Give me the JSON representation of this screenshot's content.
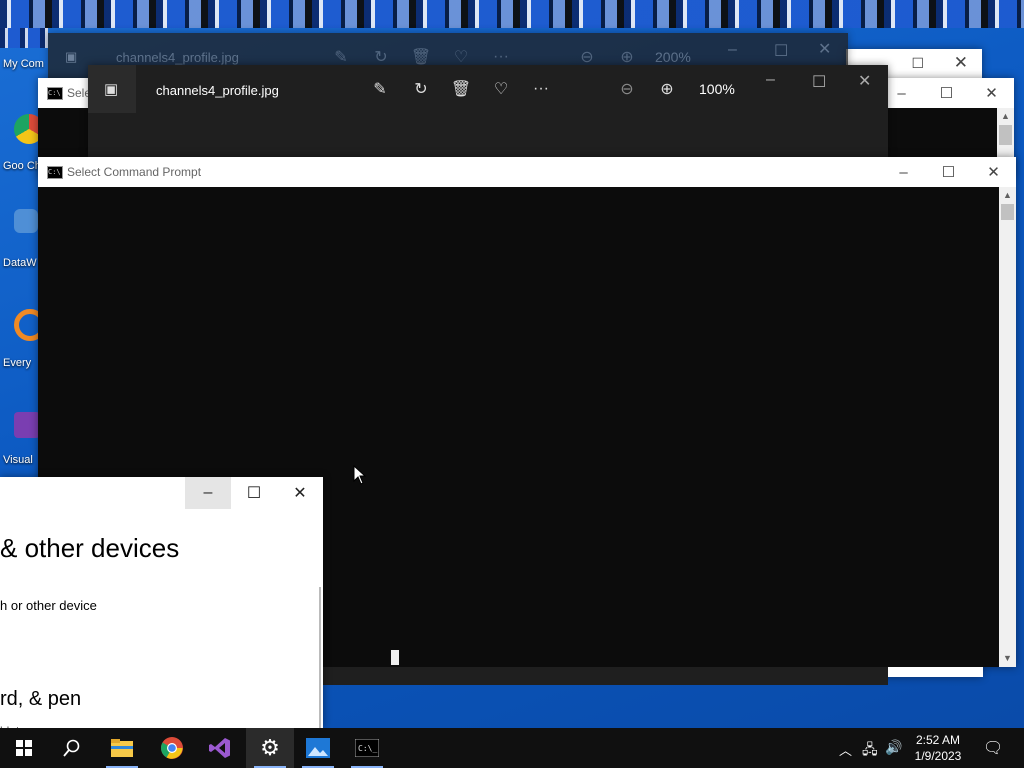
{
  "desktop": {
    "icons": [
      {
        "label": "My Com",
        "color": "#2d7fd9"
      },
      {
        "label": "Goo Chr",
        "color": "#dd4b39"
      },
      {
        "label": "DataW",
        "color": "#4f8fd6"
      },
      {
        "label": "Every",
        "color": "#f08a24"
      },
      {
        "label": "Visual",
        "color": "#7a3eb1"
      }
    ]
  },
  "photo_back": {
    "title": "channels4_profile.jpg",
    "zoom": "200%"
  },
  "photo_front": {
    "title": "channels4_profile.jpg",
    "zoom": "100%"
  },
  "cmd_back": {
    "title": "Sele"
  },
  "cmd_front": {
    "title": "Select Command Prompt"
  },
  "settings": {
    "heading": "& other devices",
    "add_device": "h or other device",
    "section": "rd, & pen",
    "sub": "blet"
  },
  "taskbar": {
    "time": "2:52 AM",
    "date": "1/9/2023",
    "apps": [
      "start-icon",
      "search-icon",
      "file-explorer-icon",
      "chrome-icon",
      "visual-studio-icon",
      "settings-icon",
      "photos-icon",
      "command-prompt-icon"
    ]
  },
  "colors": {
    "accent": "#8ab4f8",
    "taskbar": "#101010",
    "cmd_bg": "#0c0c0c",
    "photo_bg": "#1f1f1f"
  }
}
